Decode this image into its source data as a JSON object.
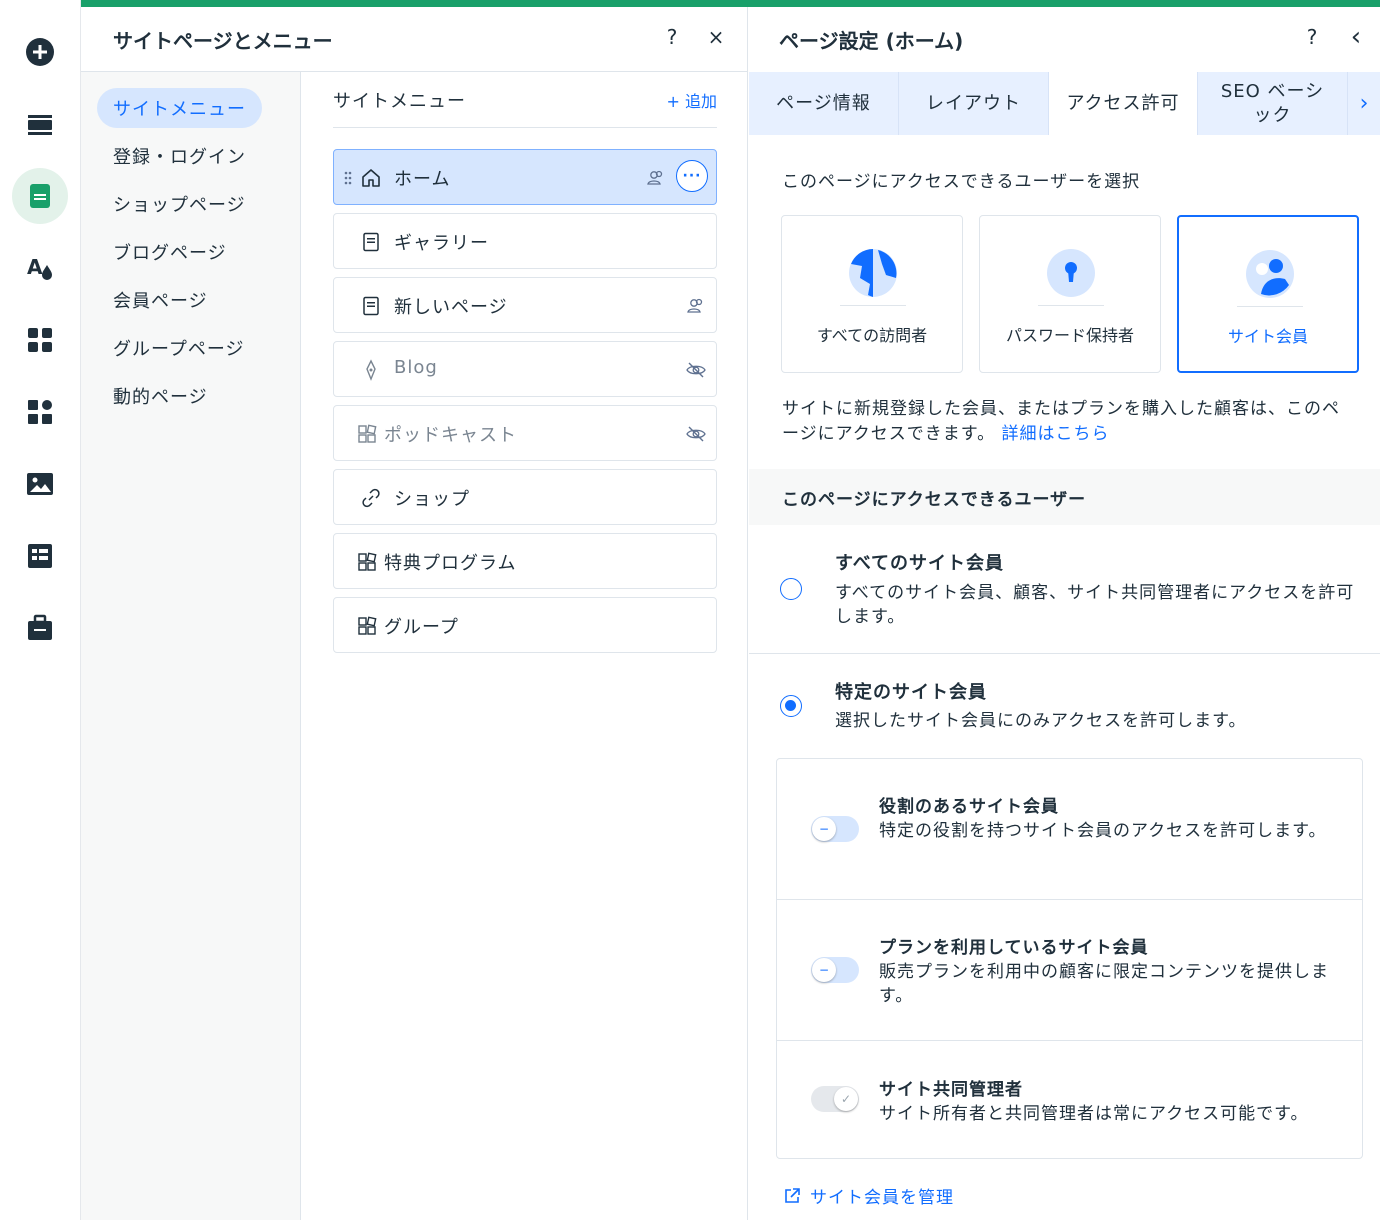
{
  "rail": {
    "icons": [
      "add-icon",
      "layout-icon",
      "pages-icon",
      "design-icon",
      "apps-icon",
      "business-apps-icon",
      "media-icon",
      "cms-icon",
      "portfolio-icon"
    ],
    "active_index": 2
  },
  "pages_panel": {
    "title": "サイトページとメニュー",
    "help": "?",
    "close": "×",
    "side_nav": [
      "サイトメニュー",
      "登録・ログイン",
      "ショップページ",
      "ブログページ",
      "会員ページ",
      "グループページ",
      "動的ページ"
    ],
    "menu_title": "サイトメニュー",
    "add_label": "+ 追加",
    "pages": [
      {
        "label": "ホーム",
        "icon": "home-icon",
        "state": "selected",
        "badge": "members-icon"
      },
      {
        "label": "ギャラリー",
        "icon": "page-icon",
        "state": "normal",
        "badge": ""
      },
      {
        "label": "新しいページ",
        "icon": "page-icon",
        "state": "normal",
        "badge": "members-icon"
      },
      {
        "label": "Blog",
        "icon": "blog-icon",
        "state": "hidden",
        "badge": "hidden-icon"
      },
      {
        "label": "ポッドキャスト",
        "icon": "app-page-icon",
        "state": "hidden",
        "badge": "hidden-icon"
      },
      {
        "label": "ショップ",
        "icon": "link-icon",
        "state": "normal",
        "badge": ""
      },
      {
        "label": "特典プログラム",
        "icon": "app-page-icon",
        "state": "normal",
        "badge": ""
      },
      {
        "label": "グループ",
        "icon": "app-page-icon",
        "state": "normal",
        "badge": ""
      }
    ],
    "more_label": "···"
  },
  "settings_panel": {
    "title": "ページ設定 (ホーム)",
    "help": "?",
    "back": "‹",
    "tabs": [
      "ページ情報",
      "レイアウト",
      "アクセス許可",
      "SEO ベーシック"
    ],
    "active_tab": 2,
    "tab_next": "›",
    "choose_label": "このページにアクセスできるユーザーを選択",
    "options": [
      {
        "label": "すべての訪問者",
        "icon": "globe-icon"
      },
      {
        "label": "パスワード保持者",
        "icon": "lock-icon"
      },
      {
        "label": "サイト会員",
        "icon": "members-icon"
      }
    ],
    "selected_option": 2,
    "description": "サイトに新規登録した会員、またはプランを購入した顧客は、このページにアクセスできます。",
    "learn_more": "詳細はこちら",
    "who_title": "このページにアクセスできるユーザー",
    "radio_all": {
      "title": "すべてのサイト会員",
      "sub": "すべてのサイト会員、顧客、サイト共同管理者にアクセスを許可します。",
      "checked": false
    },
    "radio_specific": {
      "title": "特定のサイト会員",
      "sub": "選択したサイト会員にのみアクセスを許可します。",
      "checked": true
    },
    "toggles": [
      {
        "title": "役割のあるサイト会員",
        "sub": "特定の役割を持つサイト会員のアクセスを許可します。",
        "on": false,
        "disabled": false
      },
      {
        "title": "プランを利用しているサイト会員",
        "sub": "販売プランを利用中の顧客に限定コンテンツを提供します。",
        "on": false,
        "disabled": false
      },
      {
        "title": "サイト共同管理者",
        "sub": "サイト所有者と共同管理者は常にアクセス可能です。",
        "on": true,
        "disabled": true
      }
    ],
    "manage_link": "サイト会員を管理"
  },
  "colors": {
    "accent": "#19a06a",
    "primary": "#116dff",
    "selected_bg": "#d6e6fe",
    "text": "#20303c"
  }
}
